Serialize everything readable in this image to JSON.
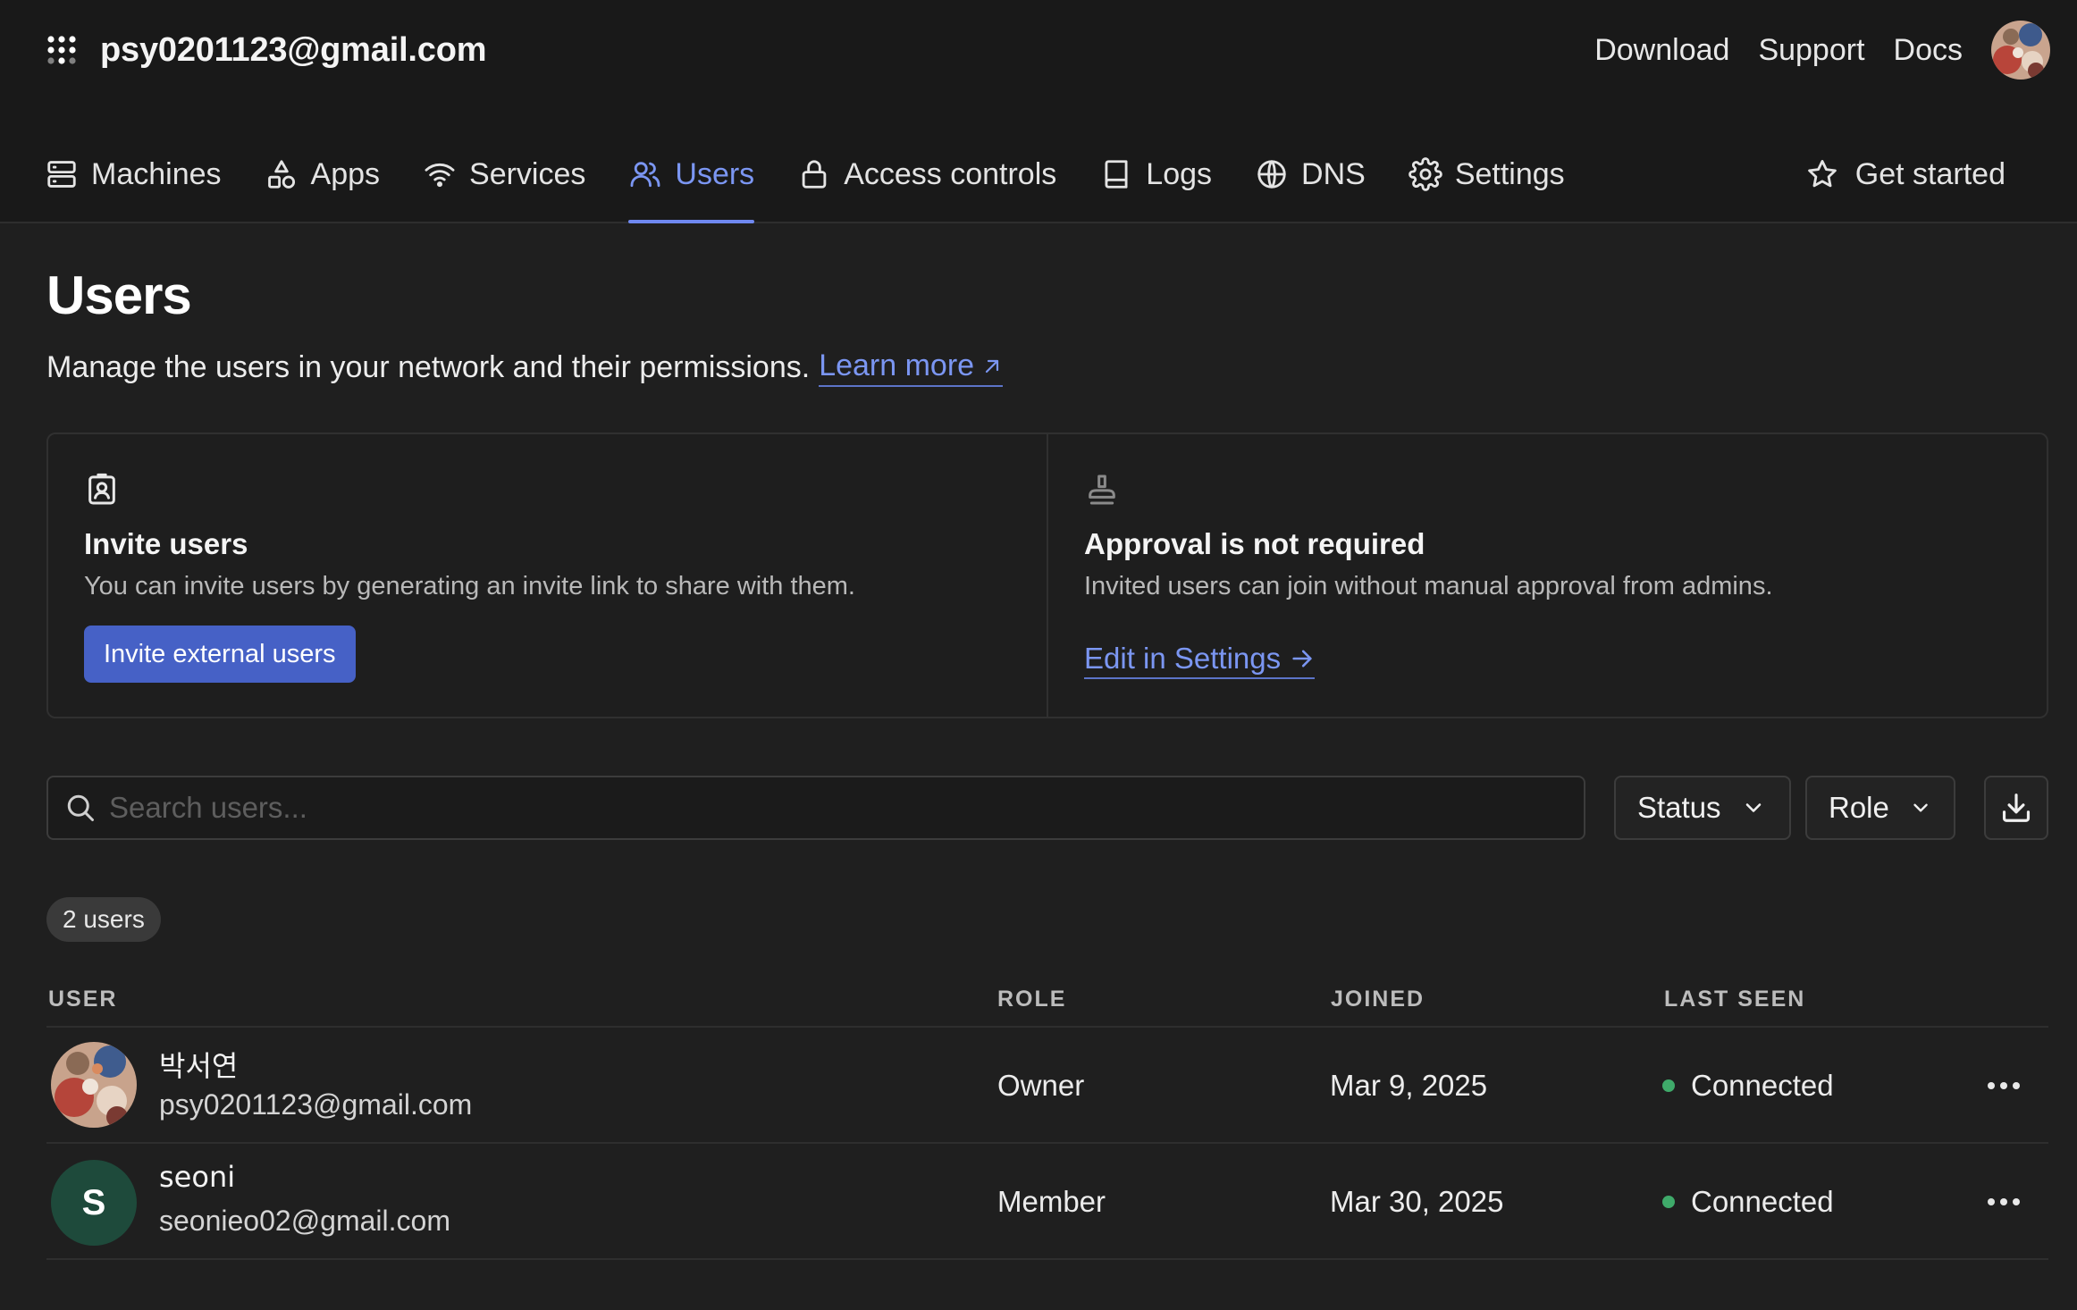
{
  "header": {
    "account": "psy0201123@gmail.com",
    "links": {
      "download": "Download",
      "support": "Support",
      "docs": "Docs"
    }
  },
  "nav": {
    "items": [
      {
        "label": "Machines",
        "icon": "machines-icon"
      },
      {
        "label": "Apps",
        "icon": "apps-icon"
      },
      {
        "label": "Services",
        "icon": "wifi-icon"
      },
      {
        "label": "Users",
        "icon": "users-icon",
        "active": true
      },
      {
        "label": "Access controls",
        "icon": "lock-icon"
      },
      {
        "label": "Logs",
        "icon": "book-icon"
      },
      {
        "label": "DNS",
        "icon": "globe-icon"
      },
      {
        "label": "Settings",
        "icon": "gear-icon"
      }
    ],
    "get_started": "Get started"
  },
  "page": {
    "title": "Users",
    "description": "Manage the users in your network and their permissions.",
    "learn_more": "Learn more"
  },
  "cards": {
    "invite": {
      "title": "Invite users",
      "description": "You can invite users by generating an invite link to share with them.",
      "button": "Invite external users"
    },
    "approval": {
      "title": "Approval is not required",
      "description": "Invited users can join without manual approval from admins.",
      "link": "Edit in Settings"
    }
  },
  "filters": {
    "search_placeholder": "Search users...",
    "status": "Status",
    "role": "Role"
  },
  "count": "2 users",
  "table": {
    "columns": {
      "user": "USER",
      "role": "ROLE",
      "joined": "JOINED",
      "last_seen": "LAST SEEN"
    },
    "rows": [
      {
        "name": "박서연",
        "email": "psy0201123@gmail.com",
        "role": "Owner",
        "joined": "Mar 9, 2025",
        "last_seen": "Connected"
      },
      {
        "name": "seoni",
        "email": "seonieo02@gmail.com",
        "initial": "S",
        "role": "Member",
        "joined": "Mar 30, 2025",
        "last_seen": "Connected"
      }
    ]
  },
  "colors": {
    "accent": "#7b96f2",
    "primary_button": "#4661c6",
    "connected": "#3faa6a",
    "avatar_initial_bg": "#1e4a3b"
  }
}
